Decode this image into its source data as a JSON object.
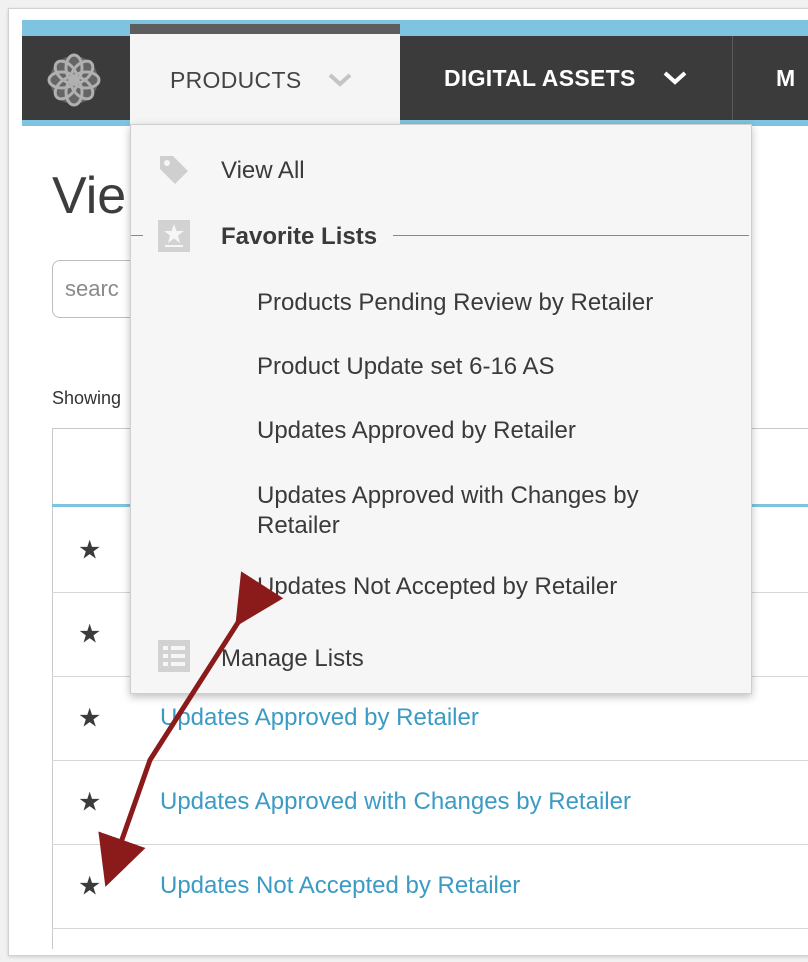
{
  "nav": {
    "products_label": "PRODUCTS",
    "digital_assets_label": "DIGITAL ASSETS",
    "more_label": "M"
  },
  "page": {
    "title": "Vie",
    "search_placeholder": "searc",
    "showing": "Showing"
  },
  "dropdown": {
    "view_all": "View All",
    "favorite_lists": "Favorite Lists",
    "favorites": [
      "Products Pending Review by Retailer",
      "Product Update set 6-16 AS",
      "Updates Approved by Retailer",
      "Updates Approved with Changes by Retailer",
      "Updates Not Accepted by Retailer"
    ],
    "manage_lists": "Manage Lists"
  },
  "rows": [
    {
      "label": ""
    },
    {
      "label": ""
    },
    {
      "label": "Updates Approved by Retailer"
    },
    {
      "label": "Updates Approved with Changes by Retailer"
    },
    {
      "label": "Updates Not Accepted by Retailer"
    }
  ],
  "colors": {
    "nav_bg": "#3b3b3b",
    "accent": "#7ec3df",
    "link": "#3b9bc4",
    "arrow": "#8b1a1a"
  }
}
